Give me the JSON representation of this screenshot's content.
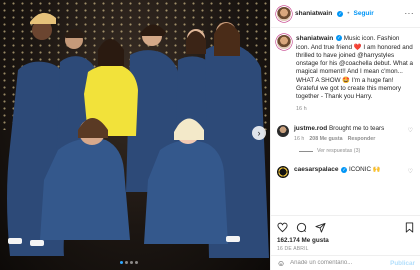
{
  "post_author": {
    "username": "shaniatwain",
    "separator": "•",
    "follow_label": "Seguir",
    "more_label": "···"
  },
  "caption": {
    "text": "Music icon. Fashion icon. And true friend ❤️ I am honored and thrilled to have joined @harrystyles onstage for his @coachella debut. What a magical moment!! And I mean c'mon... WHAT A SHOW 🤩 I'm a huge fan! Grateful we got to create this memory together - Thank you Harry.",
    "time": "16 h"
  },
  "comments": [
    {
      "username": "justme.rod",
      "text": "Brought me to tears",
      "time": "16 h",
      "likes": "208 Me gusta",
      "reply": "Responder",
      "replies_label": "Ver respuestas (3)"
    },
    {
      "username": "caesarspalace",
      "text": "ICONIC 🙌",
      "time": "",
      "likes": "",
      "reply": "",
      "replies_label": ""
    }
  ],
  "stats": {
    "likes": "162.174 Me gusta",
    "date": "16 DE ABRIL"
  },
  "comment_box": {
    "emoji": "☺",
    "placeholder": "Añade un comentario...",
    "publish": "Publicar"
  },
  "photo": {
    "nav_next": "›",
    "description": "Group photo of nine people in matching denim outfits"
  },
  "colors": {
    "accent": "#0095f6",
    "publish_disabled": "#b2dffc",
    "heart": "#ed4956"
  },
  "icons": [
    "heart-icon",
    "comment-icon",
    "share-icon",
    "bookmark-icon",
    "verified-icon",
    "more-icon",
    "emoji-icon",
    "chevron-right-icon"
  ]
}
